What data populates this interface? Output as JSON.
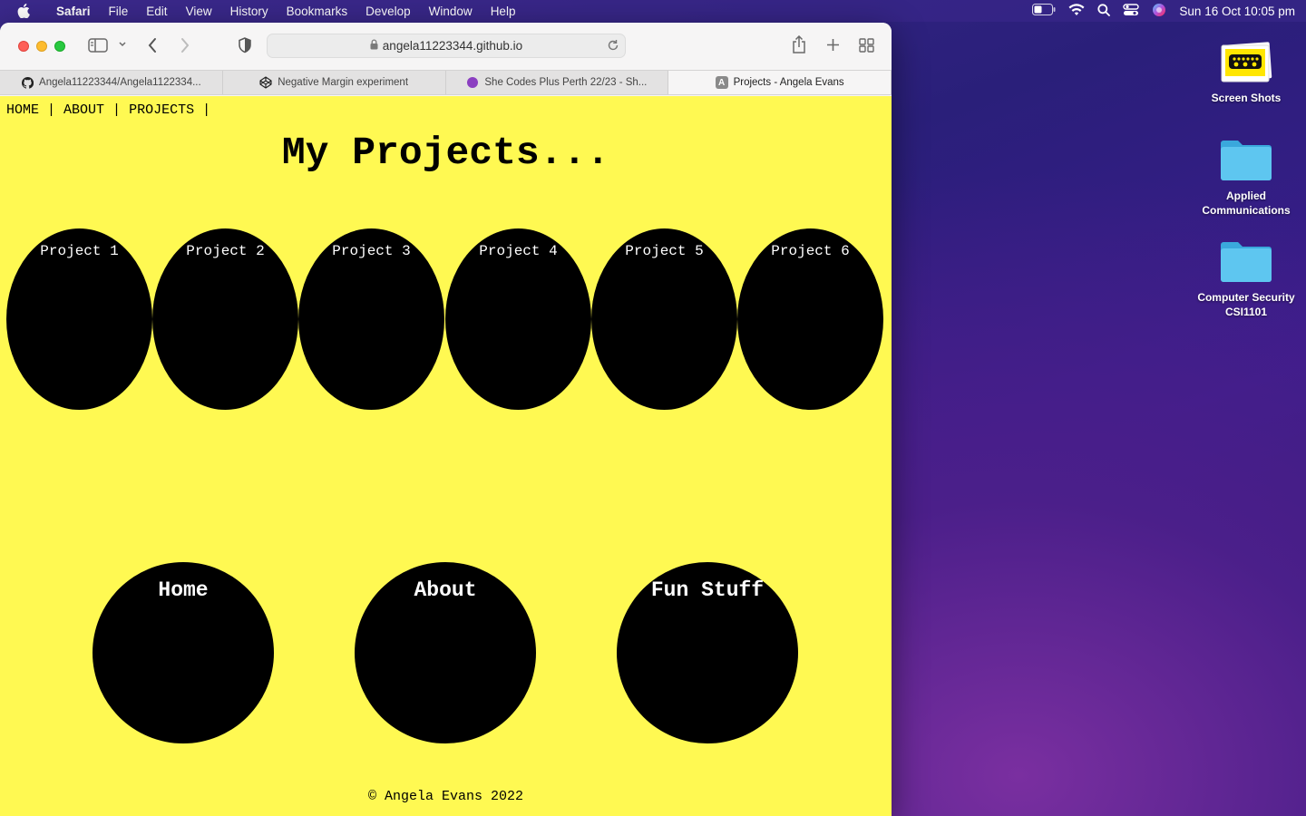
{
  "menubar": {
    "app": "Safari",
    "items": [
      "File",
      "Edit",
      "View",
      "History",
      "Bookmarks",
      "Develop",
      "Window",
      "Help"
    ],
    "clock": "Sun 16 Oct  10:05 pm"
  },
  "browser": {
    "url": "angela11223344.github.io",
    "tabs": [
      {
        "label": "Angela11223344/Angela1122334..."
      },
      {
        "label": "Negative Margin experiment"
      },
      {
        "label": "She Codes Plus Perth 22/23 - Sh..."
      },
      {
        "label": "Projects - Angela Evans",
        "favicon": "A"
      }
    ]
  },
  "page": {
    "nav": {
      "home": "HOME",
      "about": "ABOUT",
      "projects": "PROJECTS",
      "sep": " | "
    },
    "title": "My Projects...",
    "projects": [
      "Project 1",
      "Project 2",
      "Project 3",
      "Project 4",
      "Project 5",
      "Project 6"
    ],
    "links": [
      "Home",
      "About",
      "Fun Stuff"
    ],
    "footer": "© Angela Evans 2022",
    "colors": {
      "background": "#fff952",
      "circle": "#000000"
    }
  },
  "desktop": {
    "items": [
      {
        "label_line1": "Screen Shots",
        "label_line2": ""
      },
      {
        "label_line1": "Applied",
        "label_line2": "Communications"
      },
      {
        "label_line1": "Computer Security",
        "label_line2": "CSI1101"
      }
    ]
  }
}
